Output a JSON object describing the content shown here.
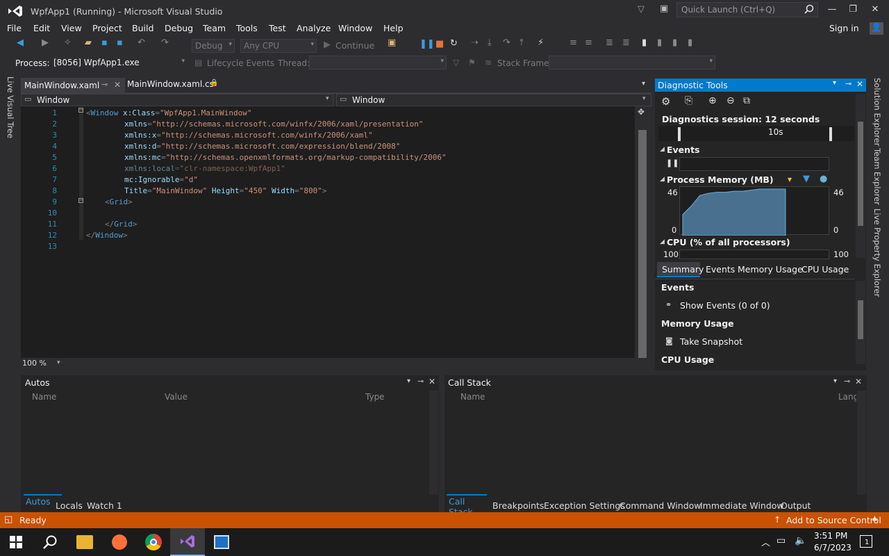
{
  "window": {
    "title": "WpfApp1 (Running) - Microsoft Visual Studio",
    "quick_launch": "Quick Launch (Ctrl+Q)"
  },
  "menu": [
    "File",
    "Edit",
    "View",
    "Project",
    "Build",
    "Debug",
    "Team",
    "Tools",
    "Test",
    "Analyze",
    "Window",
    "Help"
  ],
  "sign_in": "Sign in",
  "toolbar": {
    "config": "Debug",
    "platform": "Any CPU",
    "continue": "Continue"
  },
  "toolbar2": {
    "process_label": "Process:",
    "process_value": "[8056] WpfApp1.exe",
    "lifecycle": "Lifecycle Events",
    "thread_label": "Thread:",
    "stackframe_label": "Stack Frame:"
  },
  "editor": {
    "tabs": [
      {
        "label": "MainWindow.xaml",
        "active": true
      },
      {
        "label": "MainWindow.xaml.cs",
        "active": false
      }
    ],
    "nav_left": "Window",
    "nav_right": "Window",
    "zoom": "100 %",
    "lines": [
      "1",
      "2",
      "3",
      "4",
      "5",
      "6",
      "7",
      "8",
      "9",
      "10",
      "11",
      "12",
      "13"
    ],
    "code": {
      "l1_tag": "Window",
      "l1_attr": "x:Class",
      "l1_val": "\"WpfApp1.MainWindow\"",
      "l2_attr": "xmlns",
      "l2_val": "\"http://schemas.microsoft.com/winfx/2006/xaml/presentation\"",
      "l3_attr": "xmlns:x",
      "l3_val": "\"http://schemas.microsoft.com/winfx/2006/xaml\"",
      "l4_attr": "xmlns:d",
      "l4_val": "\"http://schemas.microsoft.com/expression/blend/2008\"",
      "l5_attr": "xmlns:mc",
      "l5_val": "\"http://schemas.openxmlformats.org/markup-compatibility/2006\"",
      "l6_attr": "xmlns:local",
      "l6_val": "\"clr-namespace:WpfApp1\"",
      "l7_attr": "mc:Ignorable",
      "l7_val": "\"d\"",
      "l8_attr1": "Title",
      "l8_val1": "\"MainWindow\"",
      "l8_attr2": "Height",
      "l8_val2": "\"450\"",
      "l8_attr3": "Width",
      "l8_val3": "\"800\"",
      "l9_tag": "Grid",
      "l11_tag": "Grid",
      "l12_tag": "Window"
    }
  },
  "diagnostics": {
    "title": "Diagnostic Tools",
    "session": "Diagnostics session: 12 seconds",
    "timeline_label": "10s",
    "events": "Events",
    "memory": "Process Memory (MB)",
    "mem_max": "46",
    "mem_min": "0",
    "mem_max_r": "46",
    "mem_min_r": "0",
    "cpu": "CPU (% of all processors)",
    "cpu_max": "100",
    "cpu_max_r": "100",
    "memory_series": [
      20,
      28,
      38,
      40,
      41,
      41,
      42,
      42,
      43,
      44,
      44,
      44,
      44
    ],
    "tabs": [
      "Summary",
      "Events",
      "Memory Usage",
      "CPU Usage"
    ],
    "sec_events": "Events",
    "show_events": "Show Events (0 of 0)",
    "sec_memory": "Memory Usage",
    "take_snapshot": "Take Snapshot",
    "sec_cpu": "CPU Usage"
  },
  "right_side_tabs": [
    "Solution Explorer",
    "Team Explorer",
    "Live Property Explorer"
  ],
  "left_side_tab": "Live Visual Tree",
  "autos": {
    "title": "Autos",
    "cols": [
      "Name",
      "Value",
      "Type"
    ],
    "tabs": [
      "Autos",
      "Locals",
      "Watch 1"
    ]
  },
  "callstack": {
    "title": "Call Stack",
    "cols": [
      "Name",
      "Lang"
    ],
    "tabs": [
      "Call Stack",
      "Breakpoints",
      "Exception Settings",
      "Command Window",
      "Immediate Window",
      "Output"
    ]
  },
  "status": {
    "text": "Ready",
    "source_control": "Add to Source Control"
  },
  "taskbar": {
    "time": "3:51 PM",
    "date": "6/7/2023",
    "notif": "1"
  },
  "colors": {
    "accent": "#007acc",
    "status": "#ca5100",
    "memory_fill": "#4a7090"
  }
}
